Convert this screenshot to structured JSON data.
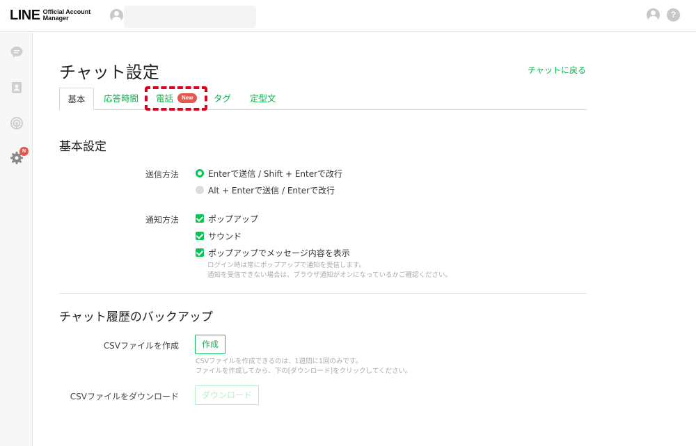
{
  "header": {
    "logo_main": "LINE",
    "logo_sub_1": "Official Account",
    "logo_sub_2": "Manager",
    "help_label": "?"
  },
  "sidebar": {
    "icons": [
      "chat-icon",
      "contacts-icon",
      "broadcast-icon",
      "settings-icon"
    ],
    "settings_badge": "N"
  },
  "page": {
    "title": "チャット設定",
    "back_link": "チャットに戻る"
  },
  "tabs": [
    {
      "label": "基本",
      "active": true
    },
    {
      "label": "応答時間"
    },
    {
      "label": "電話",
      "badge": "New"
    },
    {
      "label": "タグ"
    },
    {
      "label": "定型文"
    }
  ],
  "basic": {
    "title": "基本設定",
    "send_method": {
      "label": "送信方法",
      "options": [
        "Enterで送信 / Shift + Enterで改行",
        "Alt + Enterで送信 / Enterで改行"
      ]
    },
    "notify_method": {
      "label": "通知方法",
      "options": [
        "ポップアップ",
        "サウンド",
        "ポップアップでメッセージ内容を表示"
      ],
      "note_1": "ログイン時は常にポップアップで通知を受信します。",
      "note_2": "通知を受信できない場合は、ブラウザ通知がオンになっているかご確認ください。"
    }
  },
  "backup": {
    "title": "チャット履歴のバックアップ",
    "create_label": "CSVファイルを作成",
    "create_button": "作成",
    "note_1": "CSVファイルを作成できるのは、1週間に1回のみです。",
    "note_2": "ファイルを作成してから、下の[ダウンロード]をクリックしてください。",
    "download_label": "CSVファイルをダウンロード",
    "download_button": "ダウンロード"
  },
  "colors": {
    "accent": "#06c755",
    "link": "#06b44c",
    "badge": "#e9554f",
    "highlight": "#e0001e"
  }
}
